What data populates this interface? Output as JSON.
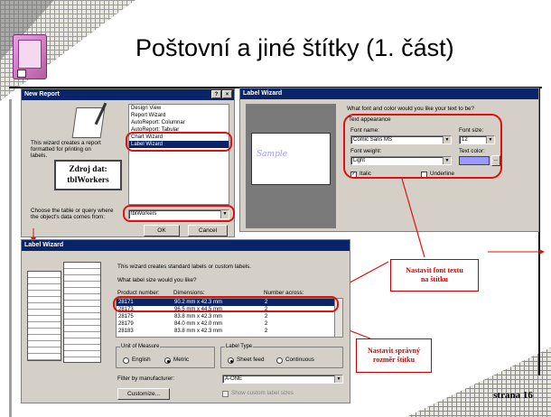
{
  "slide": {
    "title": "Poštovní a jiné štítky (1. část)",
    "page_number": "strana 16"
  },
  "new_report": {
    "title": "New Report",
    "help_btn": "?",
    "close_btn": "×",
    "description": [
      "This wizard creates a report",
      "formatted for printing on",
      "labels."
    ],
    "options": [
      "Design View",
      "Report Wizard",
      "AutoReport: Columnar",
      "AutoReport: Tabular",
      "Chart Wizard",
      "Label Wizard"
    ],
    "selected_option": "Label Wizard",
    "choose_label": [
      "Choose the table or query where",
      "the object's data comes from:"
    ],
    "source_value": "tblWorkers",
    "ok_label": "OK",
    "cancel_label": "Cancel"
  },
  "label_wizard_font": {
    "title": "Label Wizard",
    "question": "What font and color would you like your text to be?",
    "group_label": "Text appearance",
    "font_name_label": "Font name:",
    "font_name_value": "Comic Sans MS",
    "font_size_label": "Font size:",
    "font_size_value": "12",
    "font_weight_label": "Font weight:",
    "font_weight_value": "Light",
    "text_color_label": "Text color:",
    "text_color_button": "...",
    "text_color_swatch": "#9999ff",
    "italic_label": "Italic",
    "italic_checked": "✓",
    "underline_label": "Underline",
    "sample_text": "Sample"
  },
  "label_wizard_size": {
    "title": "Label Wizard",
    "intro": "This wizard creates standard labels or custom labels.",
    "question": "What label size would you like?",
    "columns": [
      "Product number:",
      "Dimensions:",
      "Number across:"
    ],
    "rows": [
      {
        "product": "28171",
        "dimensions": "90.2 mm x 42.3 mm",
        "across": "2"
      },
      {
        "product": "28173",
        "dimensions": "96.5 mm x 44.5 mm",
        "across": "2"
      },
      {
        "product": "28175",
        "dimensions": "83.8 mm x 42.3 mm",
        "across": "2"
      },
      {
        "product": "28179",
        "dimensions": "84.0 mm x 42.0 mm",
        "across": "2"
      },
      {
        "product": "28183",
        "dimensions": "83.8 mm x 42.3 mm",
        "across": "2"
      }
    ],
    "unit_group": "Unit of Measure",
    "unit_english": "English",
    "unit_metric": "Metric",
    "label_type_group": "Label Type",
    "sheet_feed": "Sheet feed",
    "continuous": "Continuous",
    "filter_label": "Filter by manufacturer:",
    "filter_value": "A-ONE",
    "customize_label": "Customize...",
    "show_custom_label": "Show custom label sizes"
  },
  "annotations": {
    "data_source": [
      "Zdroj dat:",
      "tblWorkers"
    ],
    "set_font": [
      "Nastavit font textu",
      "na štítku"
    ],
    "set_size": [
      "Nastavit správný",
      "rozměr štítku"
    ]
  },
  "colors": {
    "titlebar": "#0a246a",
    "window_bg": "#d4d0c8",
    "annotation_red": "#cc0000",
    "ring_red": "#e01010"
  }
}
